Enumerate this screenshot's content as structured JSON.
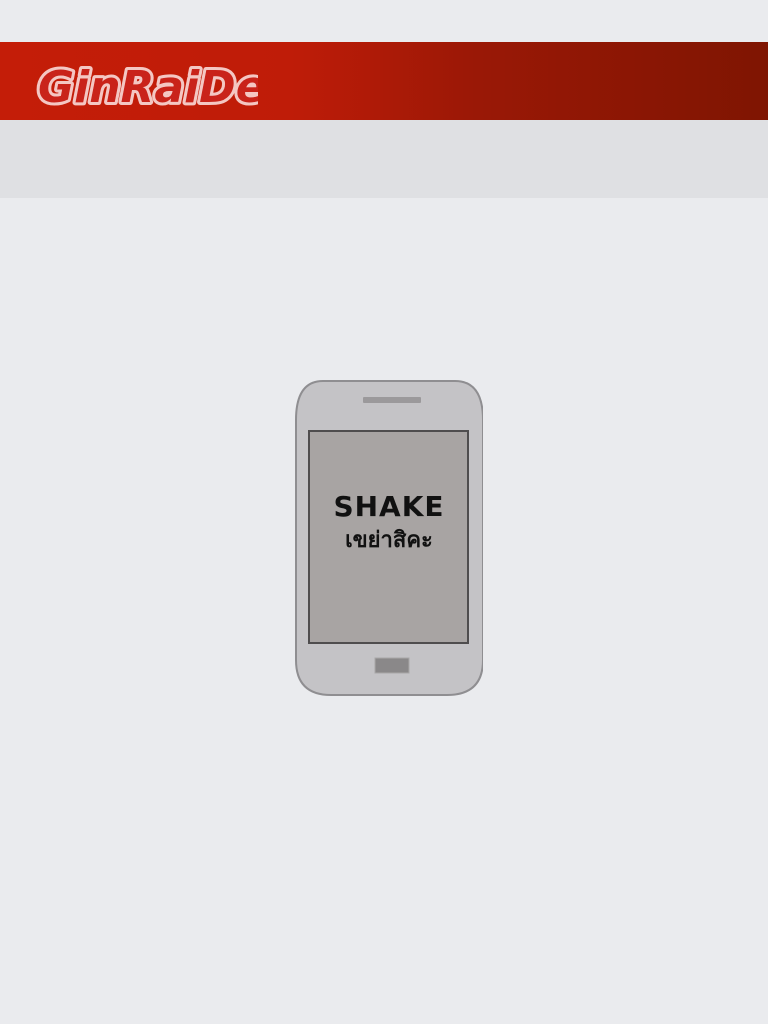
{
  "app": {
    "logo_text": "GinRaiDee",
    "colors": {
      "header_start": "#c41d08",
      "header_end": "#7f1502",
      "page_background": "#eaebee",
      "subbar_background": "#dfe0e3",
      "phone_body": "#c4c3c6",
      "phone_screen": "#a8a4a3"
    }
  },
  "header": {
    "logo_icon": "ginraidee-logo"
  },
  "main": {
    "phone_icon": "smartphone-icon",
    "shake_label_en": "SHAKE",
    "shake_label_th": "เขย่าสิคะ"
  }
}
